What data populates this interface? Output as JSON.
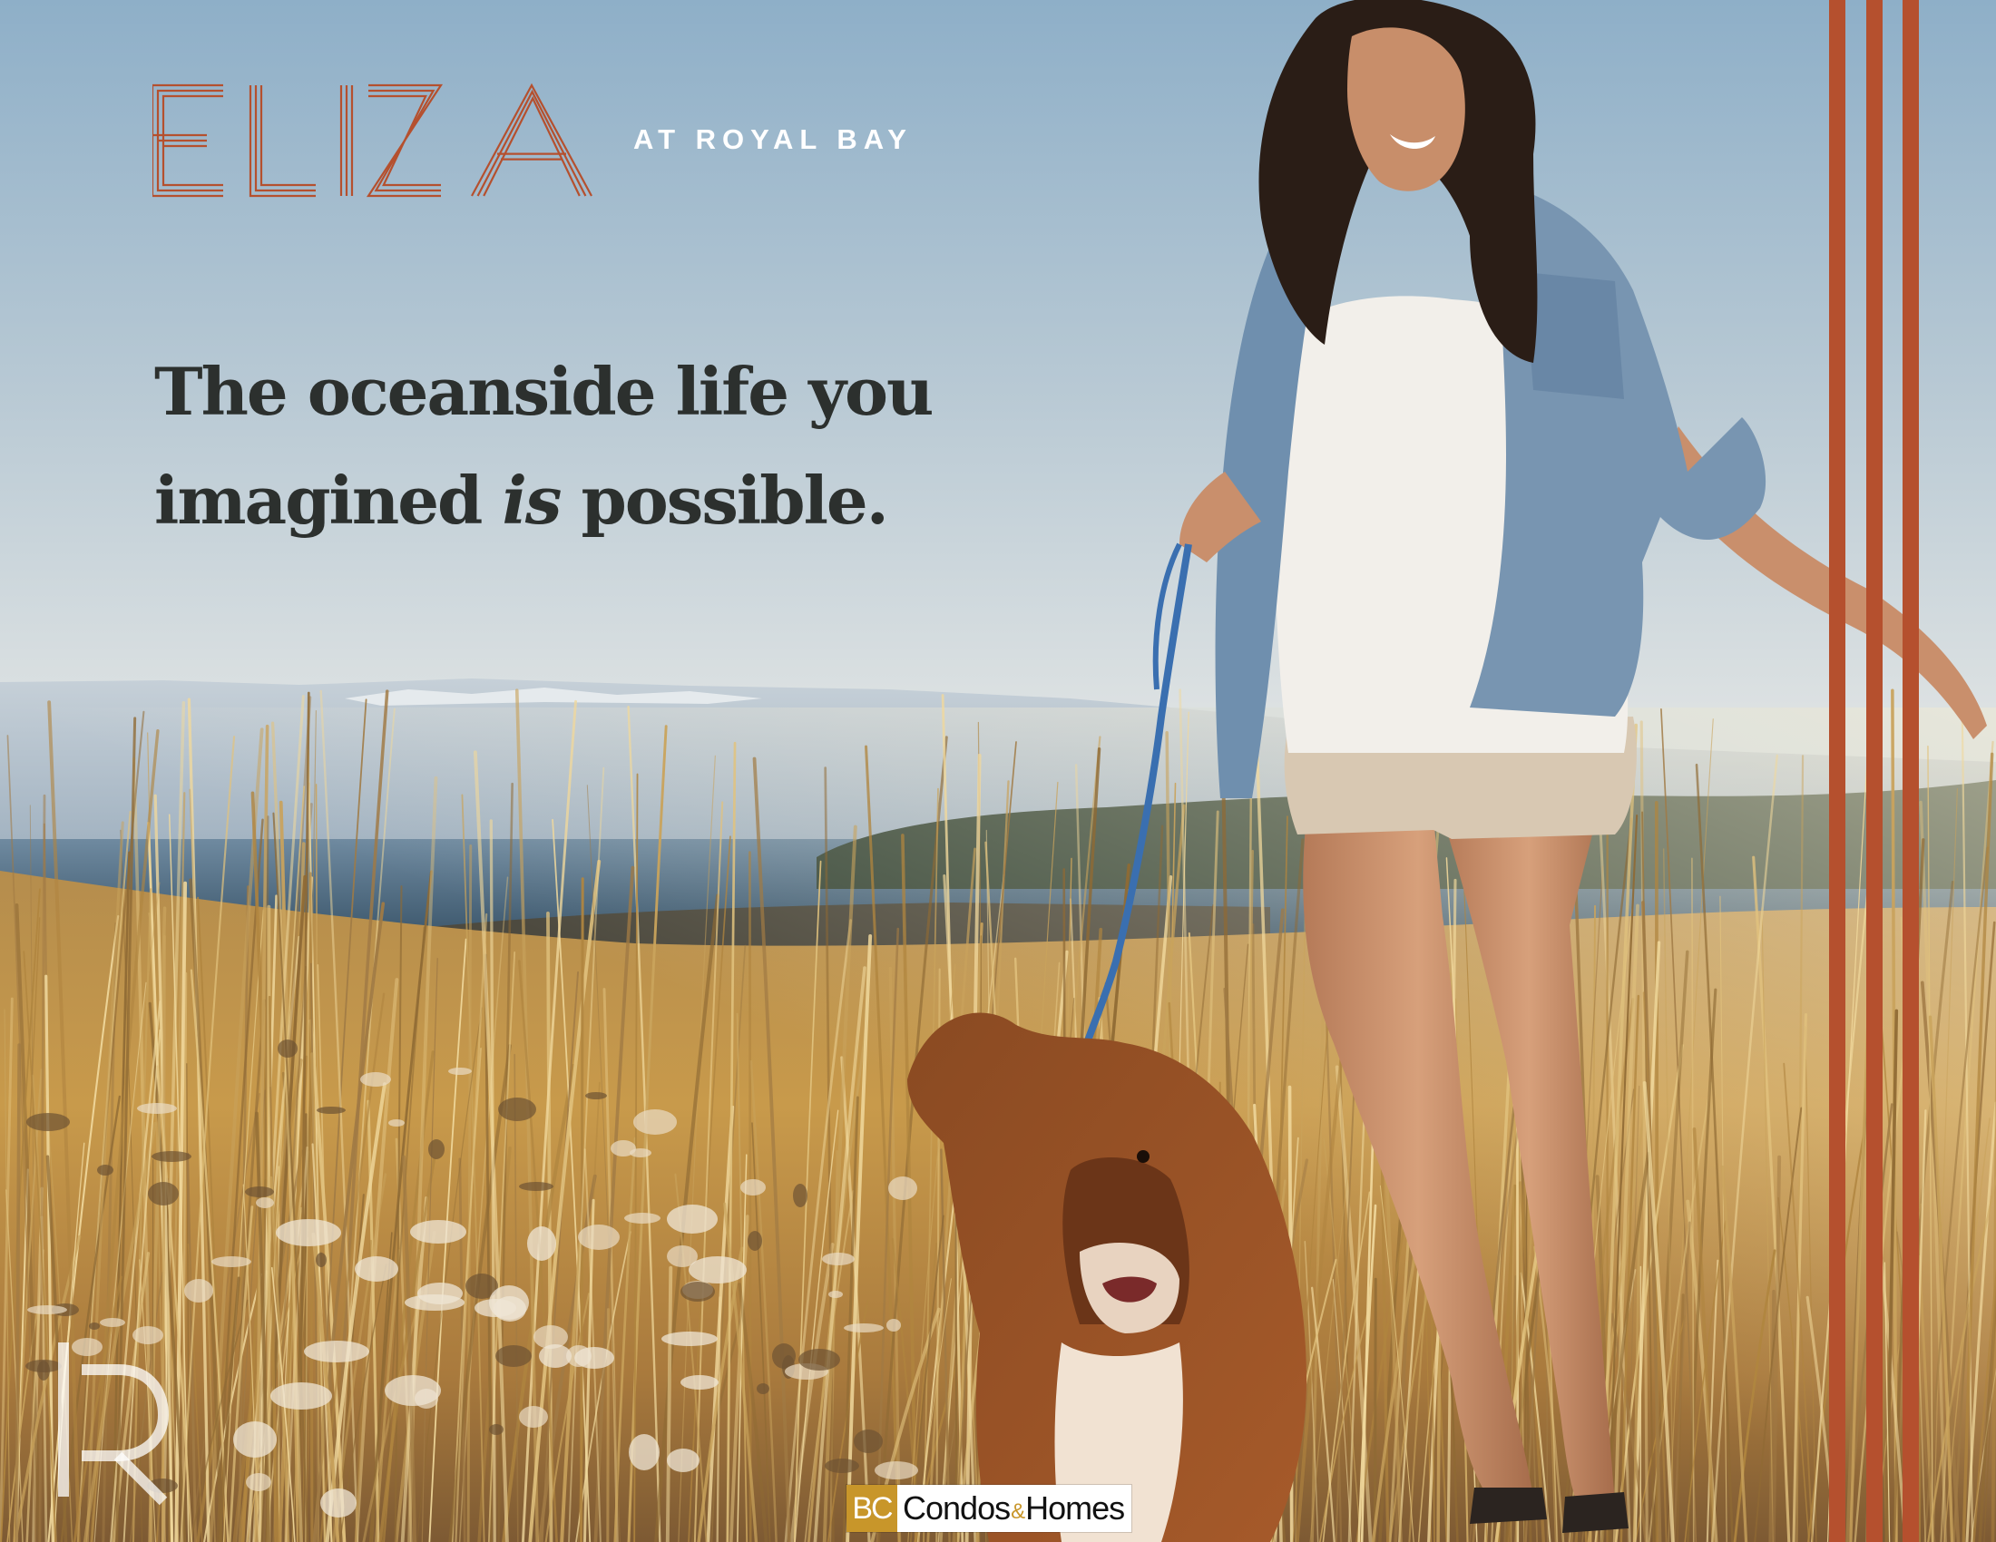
{
  "brand": {
    "wordmark": "ELIZA",
    "subtitle": "AT ROYAL BAY",
    "accent_color": "#b5502e"
  },
  "headline": {
    "line1": "The oceanside life you",
    "line2_before": "imagined",
    "line2_emphasis": "is",
    "line2_after": "possible."
  },
  "watermark": {
    "icon": "r-monogram-icon"
  },
  "badge": {
    "abbr": "BC",
    "name_part1": "Condos",
    "ampersand": "&",
    "name_part2": "Homes",
    "abbr_bg_color": "#c8962a"
  },
  "colors": {
    "sky_top": "#8fb0c9",
    "sky_bottom": "#d9dfe2",
    "sea": "#3d5b70",
    "grass": "#c79a4a",
    "headline_text": "#2c302e"
  }
}
